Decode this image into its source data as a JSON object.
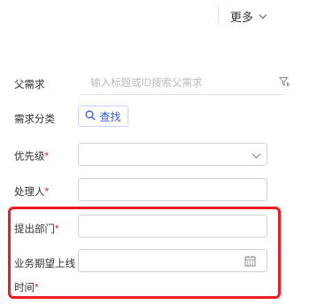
{
  "header": {
    "more_label": "更多"
  },
  "form": {
    "parent_requirement": {
      "label": "父需求",
      "placeholder": "输入标题或ID搜索父需求"
    },
    "category": {
      "label": "需求分类",
      "button_label": "查找"
    },
    "priority": {
      "label": "优先级",
      "required_mark": "*",
      "value": ""
    },
    "assignee": {
      "label": "处理人",
      "required_mark": "*",
      "value": ""
    },
    "department": {
      "label": "提出部门",
      "required_mark": "*",
      "value": ""
    },
    "expected_date": {
      "label_line1": "业务期望上线",
      "label_line2": "时间",
      "required_mark": "*",
      "value": ""
    }
  },
  "colors": {
    "accent": "#2f5bea",
    "required": "#e02020",
    "highlight": "#ee1c25"
  },
  "icons": [
    "chevron-down-icon",
    "filter-icon",
    "search-icon",
    "calendar-icon"
  ]
}
